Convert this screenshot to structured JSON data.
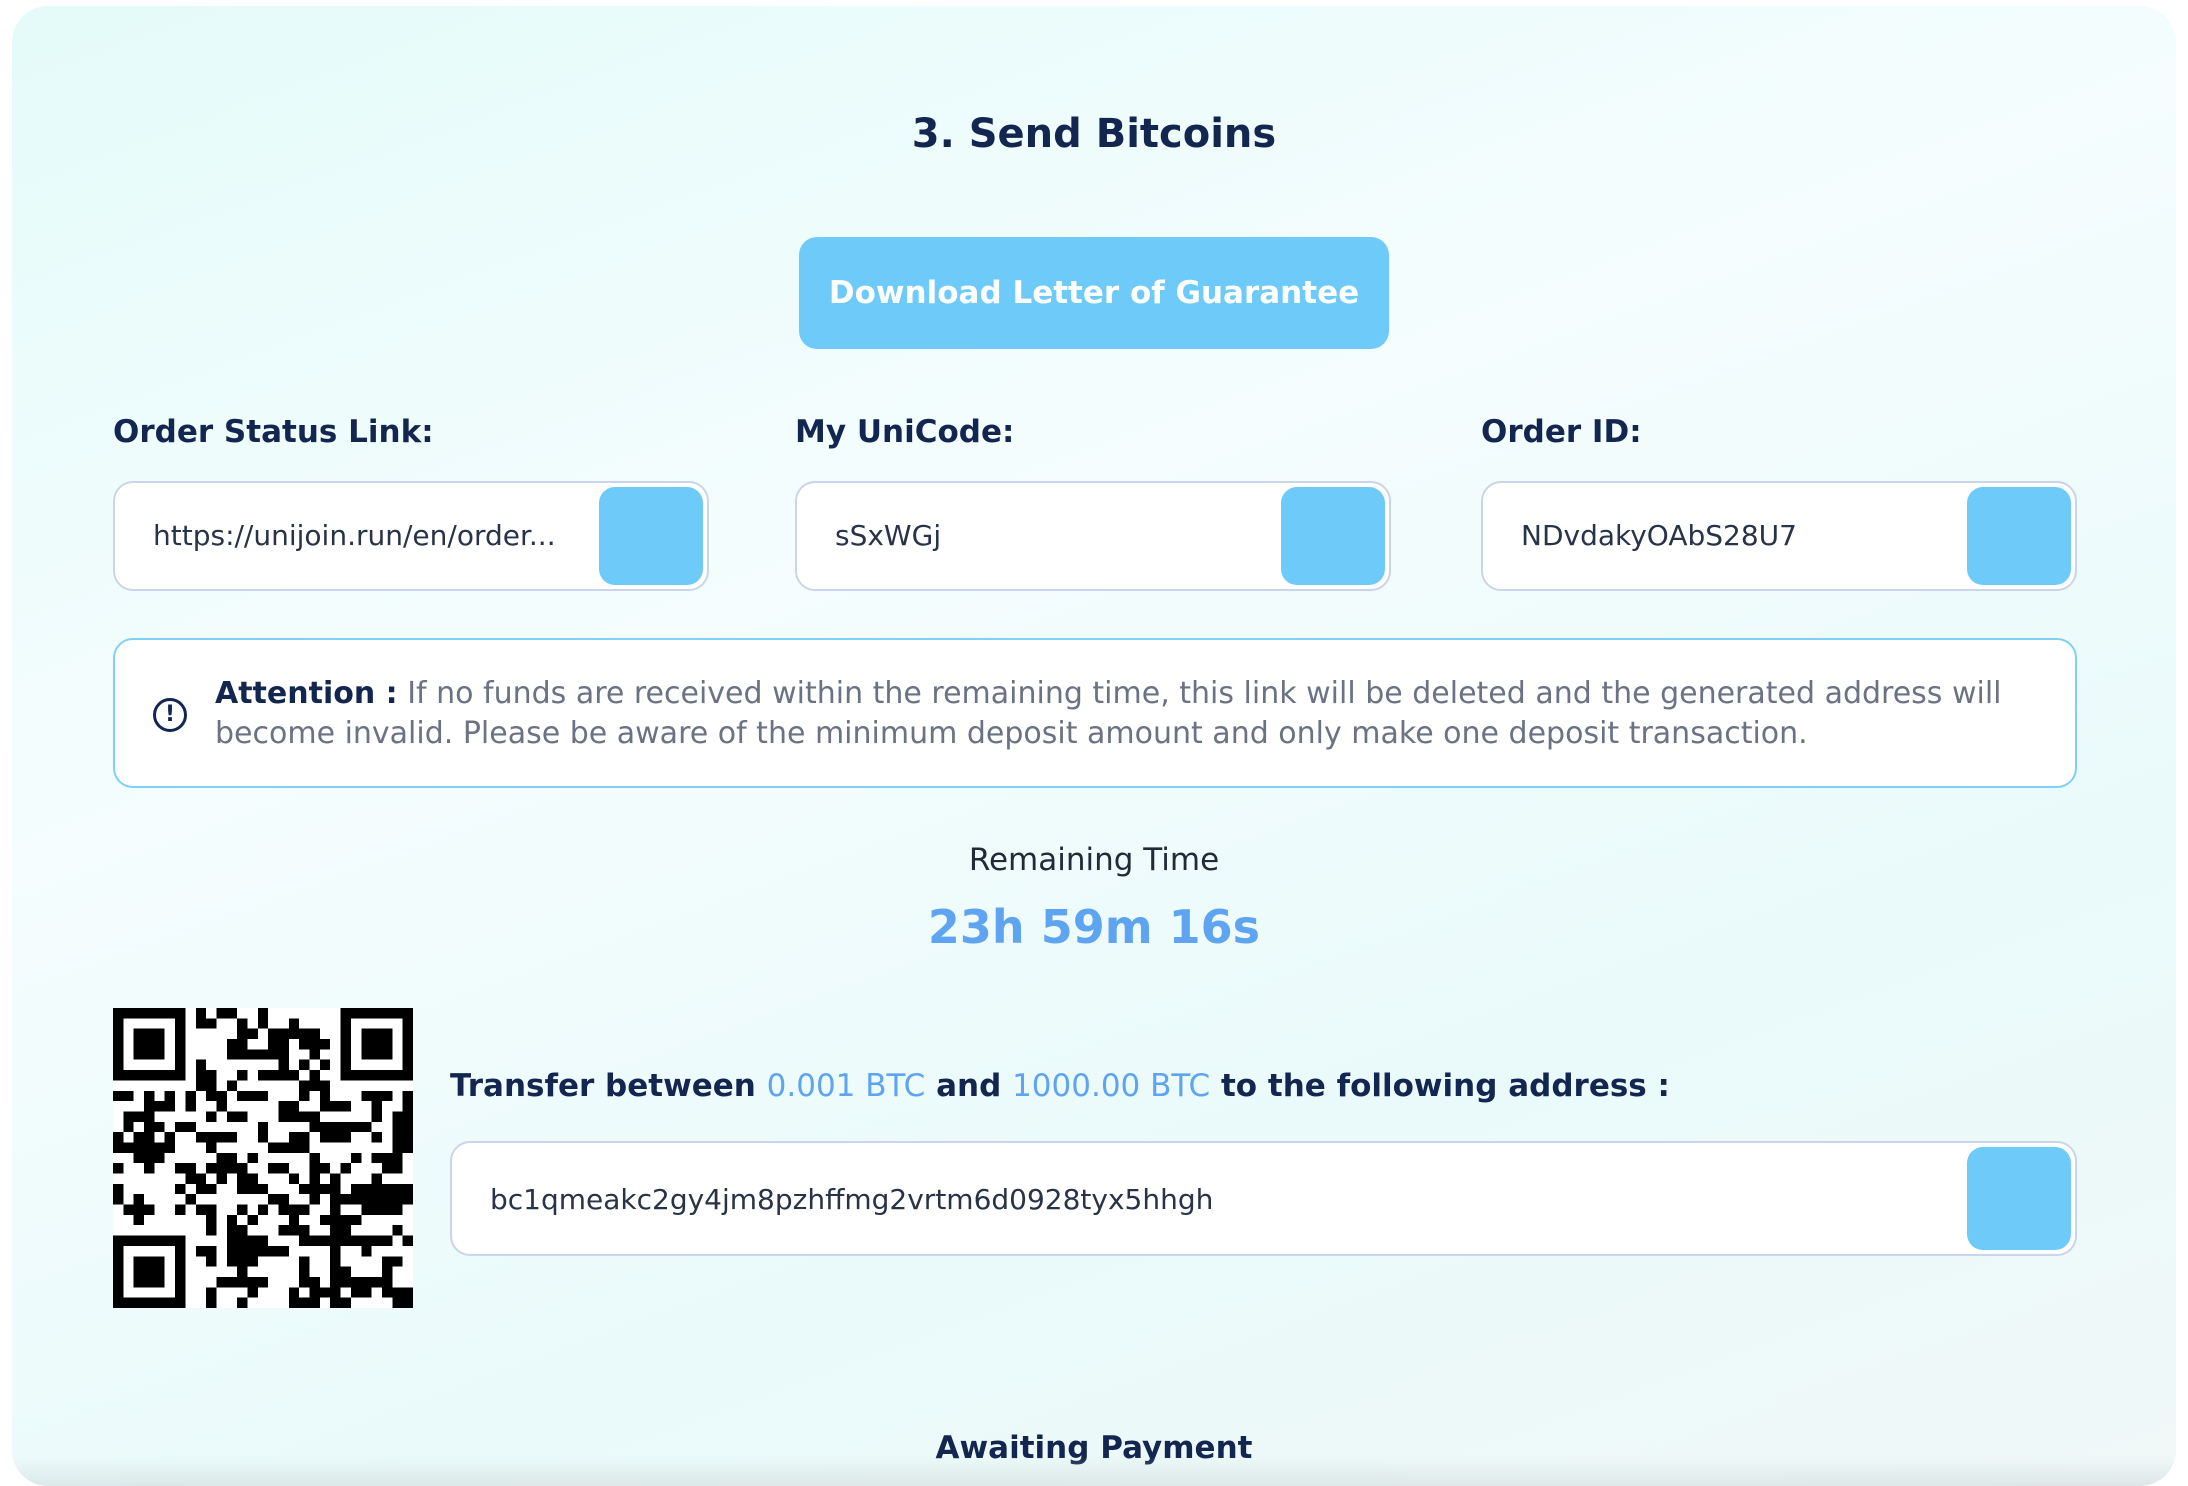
{
  "section": {
    "title": "3. Send Bitcoins"
  },
  "download_button": {
    "label": "Download Letter of Guarantee"
  },
  "fields": {
    "order_status_link": {
      "label": "Order Status Link:",
      "value": "https://unijoin.run/en/order..."
    },
    "unicode": {
      "label": "My UniCode:",
      "value": "sSxWGj"
    },
    "order_id": {
      "label": "Order ID:",
      "value": "NDvdakyOAbS28U7"
    }
  },
  "attention": {
    "icon": "exclamation-circle-icon",
    "label": "Attention :",
    "text": "If no funds are received within the remaining time, this link will be deleted and the generated address will become invalid. Please be aware of the minimum deposit amount and only make one deposit transaction."
  },
  "timer": {
    "label": "Remaining Time",
    "value": "23h 59m 16s"
  },
  "transfer": {
    "prefix": "Transfer between",
    "min_amount": "0.001 BTC",
    "connector": "and",
    "max_amount": "1000.00 BTC",
    "suffix": "to the following address :",
    "address": "bc1qmeakc2gy4jm8pzhffmg2vrtm6d0928tyx5hhgh"
  },
  "status": {
    "text": "Awaiting Payment"
  },
  "colors": {
    "accent": "#6dcaf9",
    "highlight": "#5fa4f0",
    "heading": "#12264f",
    "body_text": "#6a7283"
  }
}
